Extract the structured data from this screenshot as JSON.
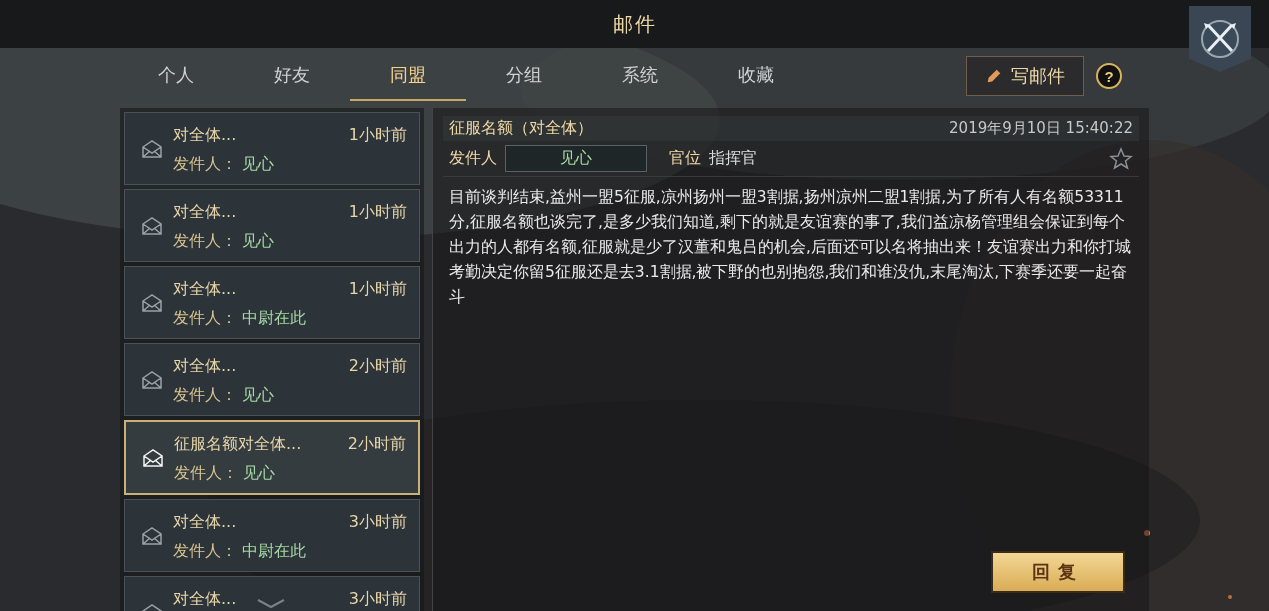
{
  "window": {
    "title": "邮件"
  },
  "tabs": [
    {
      "label": "个人",
      "selected": false
    },
    {
      "label": "好友",
      "selected": false
    },
    {
      "label": "同盟",
      "selected": true
    },
    {
      "label": "分组",
      "selected": false
    },
    {
      "label": "系统",
      "selected": false
    },
    {
      "label": "收藏",
      "selected": false
    }
  ],
  "compose_button": {
    "label": "写邮件"
  },
  "help_button": {
    "label": "?"
  },
  "mail_list": [
    {
      "title": "对全体...",
      "time": "1小时前",
      "sender_label": "发件人：",
      "sender": "见心",
      "selected": false
    },
    {
      "title": "对全体...",
      "time": "1小时前",
      "sender_label": "发件人：",
      "sender": "见心",
      "selected": false
    },
    {
      "title": "对全体...",
      "time": "1小时前",
      "sender_label": "发件人：",
      "sender": "中尉在此",
      "selected": false
    },
    {
      "title": "对全体...",
      "time": "2小时前",
      "sender_label": "发件人：",
      "sender": "见心",
      "selected": false
    },
    {
      "title": "征服名额对全体...",
      "time": "2小时前",
      "sender_label": "发件人：",
      "sender": "见心",
      "selected": true
    },
    {
      "title": "对全体...",
      "time": "3小时前",
      "sender_label": "发件人：",
      "sender": "中尉在此",
      "selected": false
    },
    {
      "title": "对全体...",
      "time": "3小时前",
      "selected": false
    }
  ],
  "message": {
    "subject": "征服名额（对全体）",
    "date": "2019年9月10日 15:40:22",
    "sender_label": "发件人",
    "sender": "见心",
    "rank_label": "官位",
    "rank": "指挥官",
    "favorite": false,
    "body": "目前谈判结束,益州一盟5征服,凉州扬州一盟3割据,扬州凉州二盟1割据,为了所有人有名额53311分,征服名额也谈完了,是多少我们知道,剩下的就是友谊赛的事了,我们益凉杨管理组会保证到每个出力的人都有名额,征服就是少了汉董和鬼吕的机会,后面还可以名将抽出来！友谊赛出力和你打城考勤决定你留5征服还是去3.1割据,被下野的也别抱怨,我们和谁没仇,末尾淘汰,下赛季还要一起奋斗"
  },
  "reply_button": {
    "label": "回复"
  }
}
